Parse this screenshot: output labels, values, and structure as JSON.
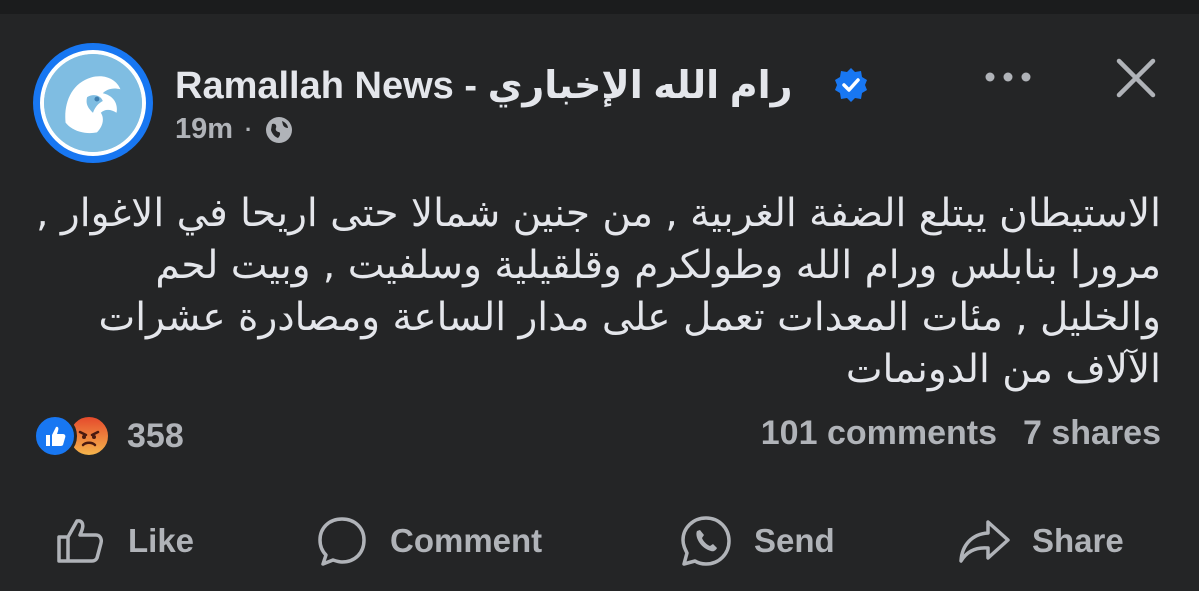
{
  "post": {
    "page_name": "Ramallah News - رام الله  الإخباري",
    "time": "19m",
    "separator": "·",
    "text": "الاستيطان يبتلع الضفة الغربية , من جنين شمالا حتى اريحا في الاغوار , مرورا بنابلس ورام الله وطولكرم وقلقيلية وسلفيت , وبيت لحم والخليل , مئات المعدات تعمل على مدار الساعة ومصادرة عشرات الآلاف من الدونمات"
  },
  "reactions": {
    "icons": [
      "like-icon",
      "angry-icon"
    ],
    "count": "358"
  },
  "stats": {
    "comments": "101 comments",
    "shares": "7 shares"
  },
  "actions": {
    "like": "Like",
    "comment": "Comment",
    "send": "Send",
    "share": "Share"
  },
  "colors": {
    "background": "#242526",
    "text": "#e4e6eb",
    "secondary": "#b0b3b8",
    "accent": "#1877f2"
  }
}
